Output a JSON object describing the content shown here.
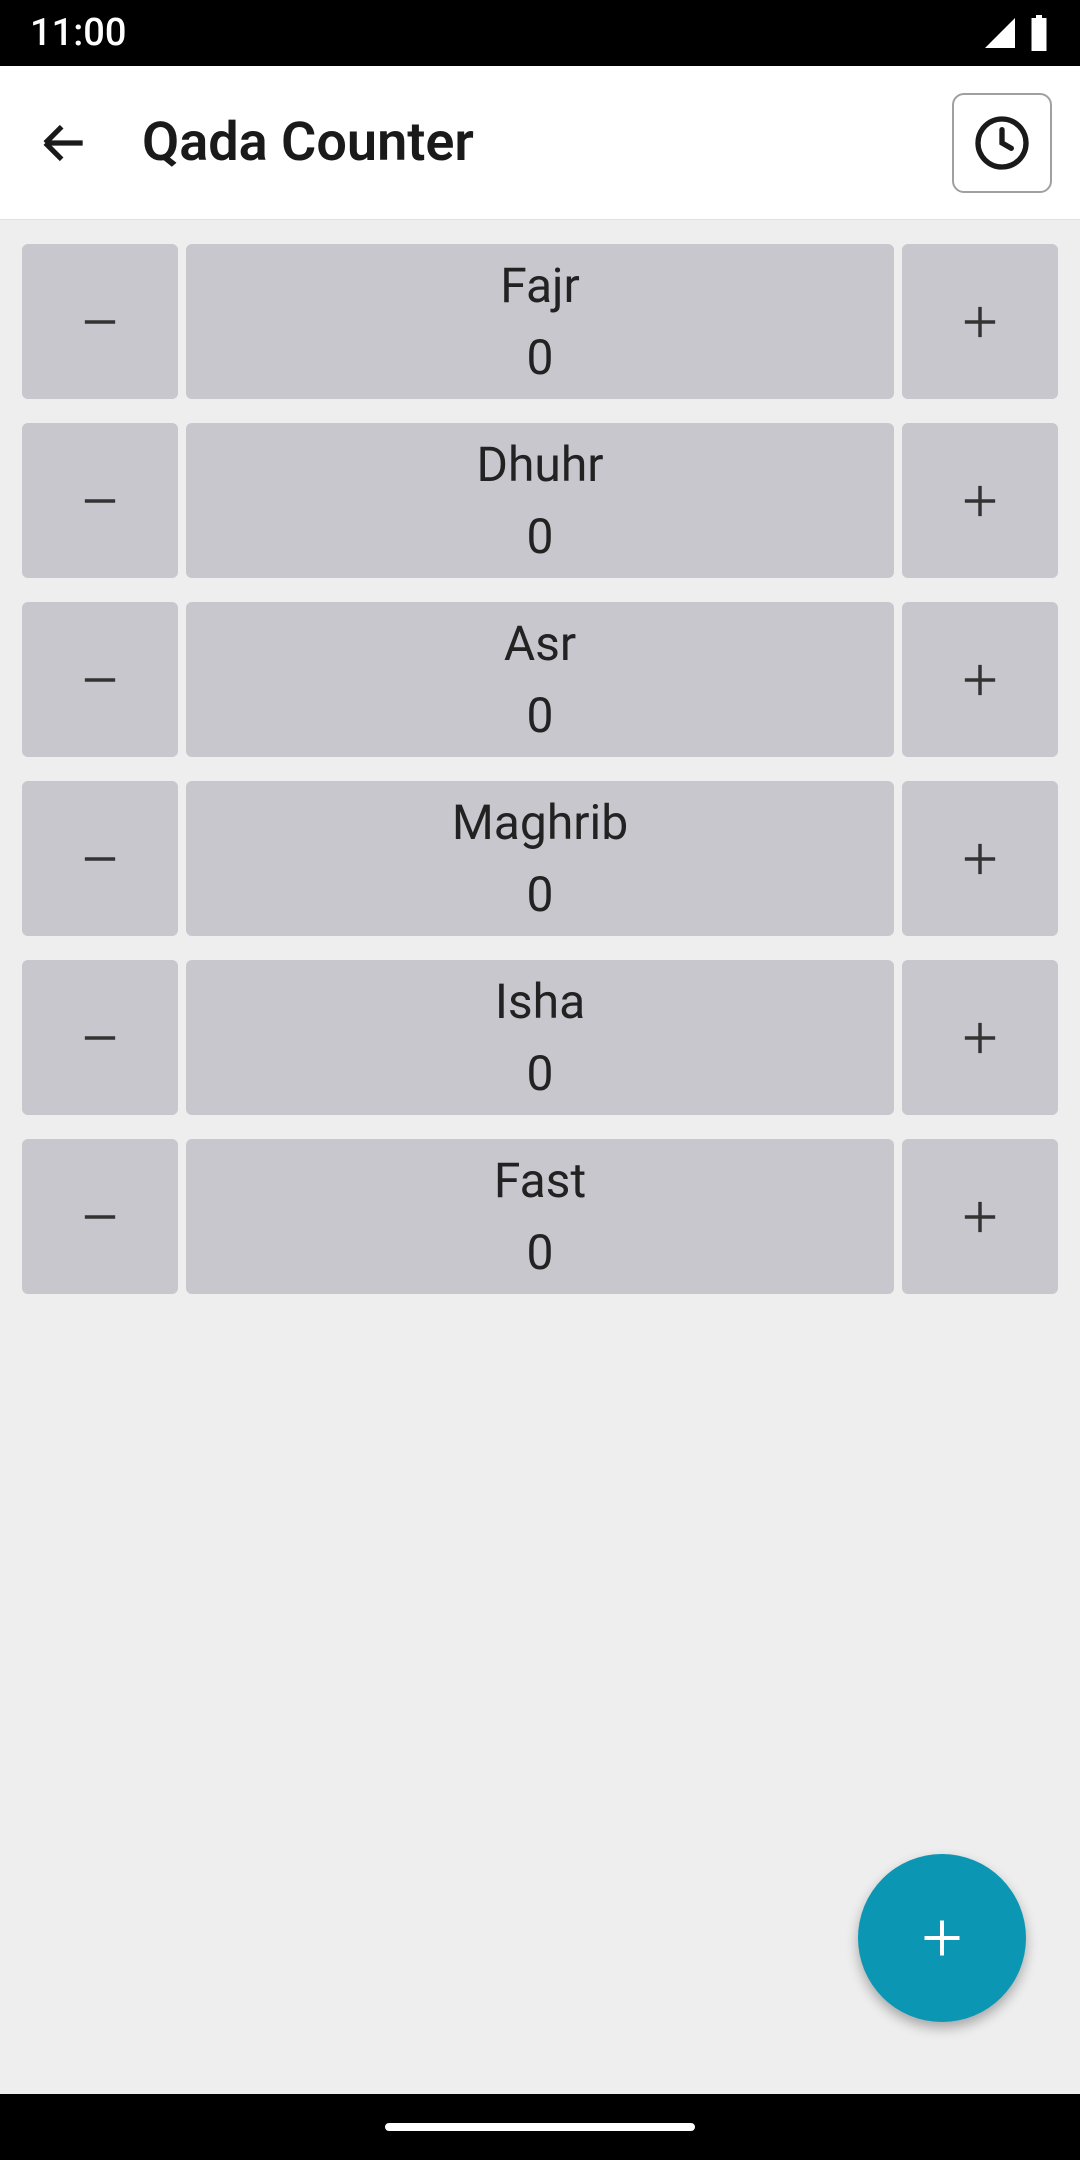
{
  "status_bar": {
    "time": "11:00"
  },
  "app_bar": {
    "title": "Qada Counter"
  },
  "counters": [
    {
      "label": "Fajr",
      "value": "0"
    },
    {
      "label": "Dhuhr",
      "value": "0"
    },
    {
      "label": "Asr",
      "value": "0"
    },
    {
      "label": "Maghrib",
      "value": "0"
    },
    {
      "label": "Isha",
      "value": "0"
    },
    {
      "label": "Fast",
      "value": "0"
    }
  ]
}
